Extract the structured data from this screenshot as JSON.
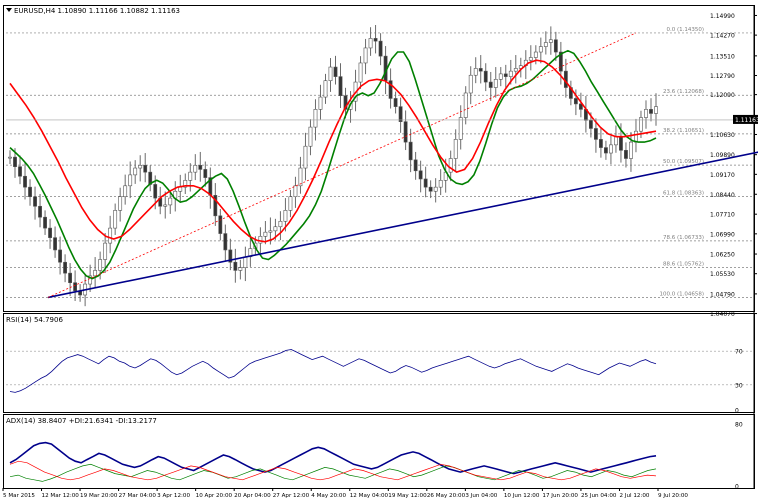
{
  "chart_data": [
    {
      "type": "candlestick",
      "title": "EURUSD,H4  1.10890 1.11166 1.10882 1.11163",
      "ylim": [
        1.042,
        1.153
      ],
      "y_ticks": [
        "1.14990",
        "1.14270",
        "1.13510",
        "1.12790",
        "1.12090",
        "1.11163",
        "1.10630",
        "1.09890",
        "1.09170",
        "1.08440",
        "1.07710",
        "1.06990",
        "1.06250",
        "1.05530",
        "1.04790",
        "1.04070"
      ],
      "current_price": "1.11163",
      "x_ticks": [
        "5 Mar 2015",
        "12 Mar 12:00",
        "19 Mar 20:00",
        "27 Mar 04:00",
        "3 Apr 12:00",
        "10 Apr 20:00",
        "20 Apr 04:00",
        "27 Apr 12:00",
        "4 May 20:00",
        "12 May 04:00",
        "19 May 12:00",
        "26 May 20:00",
        "3 Jun 04:00",
        "10 Jun 12:00",
        "17 Jun 20:00",
        "25 Jun 04:00",
        "2 Jul 12:00",
        "9 Jul 20:00"
      ],
      "fibonacci": [
        {
          "label": "0.0 (1.14350)",
          "price": 1.1435
        },
        {
          "label": "23.6 (1.12068)",
          "price": 1.12068
        },
        {
          "label": "38.2 (1.10651)",
          "price": 1.10651
        },
        {
          "label": "50.0 (1.09507)",
          "price": 1.09507
        },
        {
          "label": "61.8 (1.08363)",
          "price": 1.08363
        },
        {
          "label": "78.6 (1.06733)",
          "price": 1.06733
        },
        {
          "label": "88.6 (1.05762)",
          "price": 1.05762
        },
        {
          "label": "100.0 (1.04658)",
          "price": 1.04658
        }
      ],
      "trendline": {
        "from": {
          "bar": 0,
          "price": 1.0466
        },
        "to": {
          "bar": 164,
          "price": 1.1065
        }
      },
      "fib_diagonal": {
        "from": {
          "bar": 0,
          "price": 1.0466
        },
        "to": {
          "bar": 123,
          "price": 1.1435
        }
      },
      "series": [
        {
          "name": "Price",
          "color": "#808080",
          "values": [
            1.098,
            1.0945,
            1.091,
            1.087,
            1.0835,
            1.08,
            1.076,
            1.072,
            1.0685,
            1.064,
            1.0595,
            1.0555,
            1.052,
            1.049,
            1.0475,
            1.0515,
            1.0545,
            1.0565,
            1.0605,
            1.0665,
            1.072,
            1.0785,
            1.0835,
            1.0875,
            1.0915,
            1.094,
            1.095,
            1.0925,
            1.088,
            1.083,
            1.08,
            1.0805,
            1.083,
            1.0855,
            1.087,
            1.0895,
            1.0925,
            1.095,
            1.0935,
            1.0905,
            1.084,
            1.0765,
            1.07,
            1.064,
            1.0595,
            1.0565,
            1.0575,
            1.0615,
            1.0645,
            1.0665,
            1.069,
            1.0705,
            1.071,
            1.0725,
            1.0745,
            1.0785,
            1.0835,
            1.0875,
            1.094,
            1.102,
            1.109,
            1.1155,
            1.12,
            1.126,
            1.131,
            1.1275,
            1.1205,
            1.1155,
            1.1185,
            1.1255,
            1.1325,
            1.138,
            1.1415,
            1.1405,
            1.135,
            1.126,
            1.1195,
            1.1165,
            1.111,
            1.1035,
            1.097,
            1.093,
            1.09,
            1.087,
            1.0855,
            1.087,
            1.0895,
            1.0925,
            1.0975,
            1.1045,
            1.1125,
            1.1215,
            1.128,
            1.1305,
            1.1295,
            1.1255,
            1.1235,
            1.1265,
            1.1285,
            1.1275,
            1.1295,
            1.1305,
            1.1315,
            1.1335,
            1.1345,
            1.1365,
            1.1385,
            1.14,
            1.141,
            1.1365,
            1.1295,
            1.1235,
            1.1195,
            1.1175,
            1.1155,
            1.1115,
            1.1085,
            1.1045,
            1.1015,
            1.0995,
            1.1025,
            1.1055,
            1.1005,
            1.0975,
            1.1035,
            1.1075,
            1.1125,
            1.1155,
            1.114,
            1.1165
          ]
        },
        {
          "name": "MA Green",
          "color": "#008000",
          "values": [
            1.1015,
            1.0995,
            1.0975,
            1.095,
            1.092,
            1.088,
            1.084,
            1.0795,
            1.075,
            1.07,
            1.065,
            1.0605,
            1.057,
            1.0545,
            1.0535,
            1.0545,
            1.0565,
            1.0595,
            1.064,
            1.069,
            1.074,
            1.079,
            1.083,
            1.0865,
            1.0885,
            1.0895,
            1.0885,
            1.086,
            1.083,
            1.0815,
            1.082,
            1.0835,
            1.0855,
            1.0875,
            1.0895,
            1.091,
            1.092,
            1.09,
            1.0855,
            1.08,
            1.074,
            1.0685,
            1.064,
            1.061,
            1.0605,
            1.062,
            1.064,
            1.066,
            1.0685,
            1.071,
            1.0735,
            1.0765,
            1.0805,
            1.0855,
            1.092,
            1.099,
            1.106,
            1.1125,
            1.1175,
            1.1205,
            1.1215,
            1.1205,
            1.1215,
            1.125,
            1.1295,
            1.134,
            1.1365,
            1.1365,
            1.133,
            1.1265,
            1.1195,
            1.1125,
            1.1055,
            1.0985,
            1.0935,
            1.09,
            1.0885,
            1.088,
            1.089,
            1.0915,
            1.0965,
            1.103,
            1.11,
            1.116,
            1.12,
            1.1225,
            1.1235,
            1.124,
            1.125,
            1.1265,
            1.1285,
            1.1305,
            1.1325,
            1.1345,
            1.136,
            1.137,
            1.136,
            1.133,
            1.1295,
            1.1255,
            1.122,
            1.1185,
            1.115,
            1.1115,
            1.108,
            1.1055,
            1.104,
            1.1035,
            1.1035,
            1.104,
            1.105
          ]
        },
        {
          "name": "MA Red",
          "color": "#ff0000",
          "values": [
            1.125,
            1.121,
            1.117,
            1.1125,
            1.1075,
            1.102,
            1.0965,
            1.0905,
            1.085,
            1.0795,
            1.075,
            1.0715,
            1.069,
            1.068,
            1.069,
            1.0715,
            1.0745,
            1.0775,
            1.0805,
            1.0835,
            1.0855,
            1.087,
            1.0875,
            1.0875,
            1.0865,
            1.0845,
            1.0815,
            1.078,
            1.0745,
            1.0715,
            1.069,
            1.0675,
            1.067,
            1.068,
            1.0705,
            1.074,
            1.0785,
            1.084,
            1.09,
            1.0965,
            1.1035,
            1.11,
            1.116,
            1.1205,
            1.124,
            1.126,
            1.1265,
            1.126,
            1.124,
            1.121,
            1.117,
            1.1125,
            1.1075,
            1.1025,
            1.098,
            1.0945,
            1.0925,
            1.0935,
            1.0975,
            1.1035,
            1.1105,
            1.117,
            1.1225,
            1.1265,
            1.13,
            1.1325,
            1.1335,
            1.133,
            1.131,
            1.128,
            1.1245,
            1.1205,
            1.1165,
            1.1125,
            1.109,
            1.1065,
            1.1055,
            1.1055,
            1.106,
            1.1065,
            1.107,
            1.1075
          ]
        }
      ]
    },
    {
      "type": "line",
      "title": "RSI(14) 54.7906",
      "ylim": [
        0,
        100
      ],
      "y_ticks": [
        "70",
        "30",
        "0"
      ],
      "levels": [
        70,
        30
      ],
      "series": [
        {
          "name": "RSI(14)",
          "color": "#00008b",
          "values": [
            22,
            21,
            23,
            26,
            30,
            34,
            38,
            41,
            46,
            52,
            58,
            62,
            64,
            66,
            64,
            61,
            58,
            55,
            60,
            64,
            62,
            58,
            56,
            52,
            50,
            53,
            57,
            61,
            59,
            55,
            50,
            45,
            42,
            44,
            48,
            52,
            55,
            58,
            55,
            50,
            46,
            42,
            38,
            40,
            45,
            50,
            55,
            58,
            60,
            62,
            64,
            66,
            68,
            71,
            72,
            69,
            66,
            63,
            60,
            62,
            64,
            61,
            58,
            55,
            52,
            55,
            58,
            61,
            59,
            56,
            53,
            50,
            47,
            44,
            46,
            50,
            53,
            51,
            48,
            45,
            47,
            50,
            52,
            54,
            56,
            58,
            60,
            62,
            64,
            61,
            58,
            55,
            52,
            50,
            52,
            55,
            57,
            59,
            61,
            58,
            55,
            52,
            50,
            48,
            46,
            49,
            52,
            55,
            53,
            50,
            48,
            46,
            44,
            42,
            46,
            50,
            53,
            56,
            54,
            52,
            55,
            58,
            60,
            57,
            55
          ]
        }
      ]
    },
    {
      "type": "line",
      "title": "ADX(14) 38.8407 +DI:21.6341 -DI:13.2177",
      "ylim": [
        0,
        80
      ],
      "y_ticks": [
        "80",
        "0"
      ],
      "series": [
        {
          "name": "ADX(14)",
          "color": "#00008b",
          "values": [
            30,
            34,
            40,
            46,
            52,
            55,
            56,
            54,
            48,
            42,
            36,
            32,
            30,
            34,
            38,
            42,
            40,
            36,
            32,
            28,
            26,
            24,
            26,
            30,
            34,
            38,
            36,
            32,
            28,
            24,
            22,
            20,
            24,
            28,
            32,
            36,
            40,
            38,
            34,
            30,
            26,
            22,
            20,
            18,
            20,
            24,
            28,
            32,
            36,
            40,
            44,
            48,
            50,
            48,
            44,
            40,
            36,
            32,
            28,
            26,
            24,
            22,
            24,
            28,
            32,
            36,
            40,
            42,
            44,
            42,
            38,
            34,
            30,
            26,
            22,
            20,
            18,
            20,
            22,
            24,
            26,
            24,
            22,
            20,
            18,
            16,
            18,
            20,
            22,
            24,
            26,
            28,
            30,
            28,
            26,
            24,
            22,
            20,
            18,
            20,
            22,
            24,
            26,
            28,
            30,
            32,
            34,
            36,
            38,
            39
          ]
        },
        {
          "name": "+DI",
          "color": "#008000",
          "values": [
            12,
            14,
            10,
            8,
            6,
            9,
            13,
            18,
            22,
            26,
            28,
            24,
            20,
            16,
            14,
            12,
            16,
            20,
            18,
            14,
            10,
            8,
            12,
            16,
            20,
            18,
            14,
            10,
            12,
            16,
            20,
            22,
            18,
            14,
            10,
            8,
            12,
            16,
            20,
            24,
            22,
            18,
            14,
            12,
            10,
            14,
            18,
            22,
            20,
            16,
            12,
            14,
            18,
            22,
            26,
            24,
            20,
            16,
            12,
            10,
            8,
            12,
            16,
            20,
            18,
            14,
            10,
            12,
            16,
            20,
            18,
            14,
            12,
            16,
            20,
            18,
            14,
            12,
            16,
            20,
            22
          ]
        },
        {
          "name": "-DI",
          "color": "#ff0000",
          "values": [
            28,
            32,
            30,
            24,
            18,
            14,
            10,
            8,
            10,
            14,
            18,
            22,
            20,
            16,
            12,
            10,
            8,
            10,
            14,
            18,
            22,
            26,
            24,
            20,
            16,
            12,
            10,
            8,
            12,
            16,
            20,
            24,
            22,
            18,
            14,
            10,
            8,
            10,
            14,
            18,
            22,
            20,
            16,
            12,
            10,
            8,
            12,
            16,
            20,
            24,
            28,
            26,
            22,
            18,
            14,
            12,
            10,
            8,
            10,
            14,
            18,
            16,
            12,
            10,
            8,
            10,
            14,
            18,
            22,
            20,
            16,
            12,
            10,
            12,
            14,
            13
          ]
        }
      ]
    }
  ]
}
